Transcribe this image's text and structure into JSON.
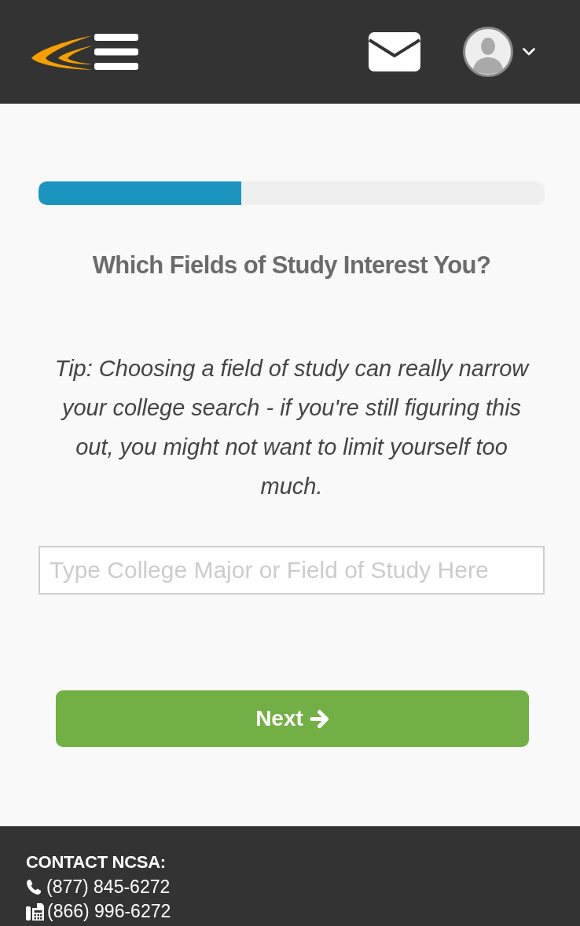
{
  "progress": {
    "level": 0.4
  },
  "title": "Which Fields of Study Interest You?",
  "tip": "Tip: Choosing a field of study can really narrow your college search - if you're still figuring this out, you might not want to limit yourself too much.",
  "search": {
    "placeholder": "Type College Major or Field of Study Here"
  },
  "next_button": {
    "label": "Next"
  },
  "footer": {
    "heading": "CONTACT NCSA:",
    "contacts": [
      {
        "kind": "phone",
        "number": "(877) 845-6272"
      },
      {
        "kind": "fax",
        "number": "(866) 996-6272"
      }
    ]
  }
}
